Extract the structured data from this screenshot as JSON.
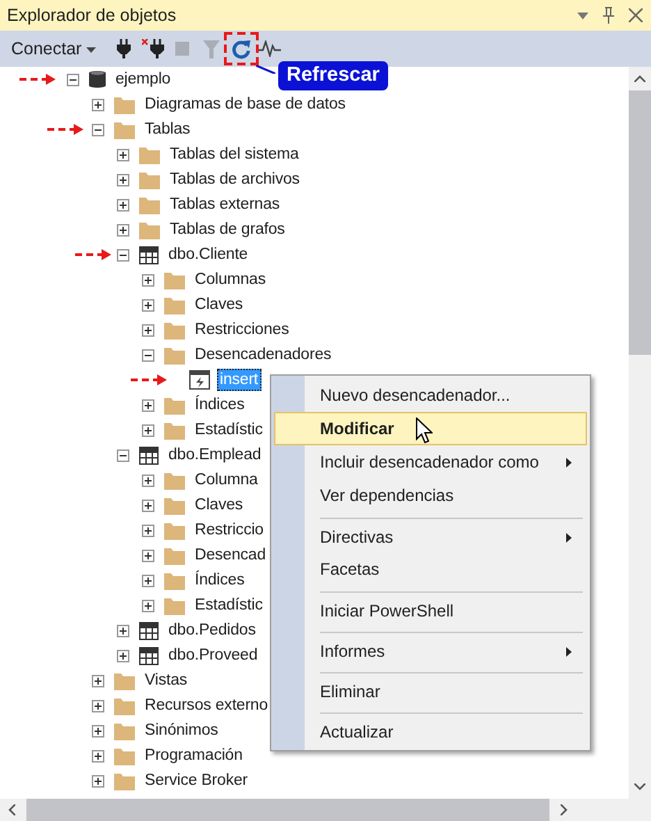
{
  "panel": {
    "title": "Explorador de objetos"
  },
  "toolbar": {
    "connect": "Conectar",
    "buttons": [
      {
        "kind": "connect",
        "disabled": false,
        "highlighted": false
      },
      {
        "kind": "disconnect",
        "disabled": false,
        "highlighted": false
      },
      {
        "kind": "stop",
        "disabled": true,
        "highlighted": false
      },
      {
        "kind": "filter",
        "disabled": true,
        "highlighted": false
      },
      {
        "kind": "refresh",
        "disabled": false,
        "highlighted": true
      },
      {
        "kind": "activity",
        "disabled": false,
        "highlighted": false
      }
    ]
  },
  "callout": {
    "text": "Refrescar"
  },
  "tree": [
    {
      "label": "ejemplo",
      "kind": "database",
      "expanded": true,
      "marked": true,
      "selected": false,
      "children": [
        {
          "label": "Diagramas de base de datos",
          "kind": "folder",
          "expanded": false,
          "marked": false,
          "selected": false
        },
        {
          "label": "Tablas",
          "kind": "folder",
          "expanded": true,
          "marked": true,
          "selected": false,
          "children": [
            {
              "label": "Tablas del sistema",
              "kind": "folder",
              "expanded": false,
              "marked": false,
              "selected": false
            },
            {
              "label": "Tablas de archivos",
              "kind": "folder",
              "expanded": false,
              "marked": false,
              "selected": false
            },
            {
              "label": "Tablas externas",
              "kind": "folder",
              "expanded": false,
              "marked": false,
              "selected": false
            },
            {
              "label": "Tablas de grafos",
              "kind": "folder",
              "expanded": false,
              "marked": false,
              "selected": false
            },
            {
              "label": "dbo.Cliente",
              "kind": "table",
              "expanded": true,
              "marked": true,
              "selected": false,
              "children": [
                {
                  "label": "Columnas",
                  "kind": "folder",
                  "expanded": false,
                  "marked": false,
                  "selected": false
                },
                {
                  "label": "Claves",
                  "kind": "folder",
                  "expanded": false,
                  "marked": false,
                  "selected": false
                },
                {
                  "label": "Restricciones",
                  "kind": "folder",
                  "expanded": false,
                  "marked": false,
                  "selected": false
                },
                {
                  "label": "Desencadenadores",
                  "kind": "folder",
                  "expanded": true,
                  "marked": false,
                  "selected": false,
                  "children": [
                    {
                      "label": "insert",
                      "kind": "trigger",
                      "marked": true,
                      "selected": true
                    }
                  ]
                },
                {
                  "label": "Índices",
                  "kind": "folder",
                  "expanded": false,
                  "marked": false,
                  "selected": false
                },
                {
                  "label": "Estadístic",
                  "kind": "folder",
                  "expanded": false,
                  "marked": false,
                  "selected": false
                }
              ]
            },
            {
              "label": "dbo.Emplead",
              "kind": "table",
              "expanded": true,
              "marked": false,
              "selected": false,
              "children": [
                {
                  "label": "Columna",
                  "kind": "folder",
                  "expanded": false,
                  "marked": false,
                  "selected": false
                },
                {
                  "label": "Claves",
                  "kind": "folder",
                  "expanded": false,
                  "marked": false,
                  "selected": false
                },
                {
                  "label": "Restriccio",
                  "kind": "folder",
                  "expanded": false,
                  "marked": false,
                  "selected": false
                },
                {
                  "label": "Desencad",
                  "kind": "folder",
                  "expanded": false,
                  "marked": false,
                  "selected": false
                },
                {
                  "label": "Índices",
                  "kind": "folder",
                  "expanded": false,
                  "marked": false,
                  "selected": false
                },
                {
                  "label": "Estadístic",
                  "kind": "folder",
                  "expanded": false,
                  "marked": false,
                  "selected": false
                }
              ]
            },
            {
              "label": "dbo.Pedidos",
              "kind": "table",
              "expanded": false,
              "marked": false,
              "selected": false
            },
            {
              "label": "dbo.Proveed",
              "kind": "table",
              "expanded": false,
              "marked": false,
              "selected": false
            }
          ]
        },
        {
          "label": "Vistas",
          "kind": "folder",
          "expanded": false,
          "marked": false,
          "selected": false
        },
        {
          "label": "Recursos externo",
          "kind": "folder",
          "expanded": false,
          "marked": false,
          "selected": false
        },
        {
          "label": "Sinónimos",
          "kind": "folder",
          "expanded": false,
          "marked": false,
          "selected": false
        },
        {
          "label": "Programación",
          "kind": "folder",
          "expanded": false,
          "marked": false,
          "selected": false
        },
        {
          "label": "Service Broker",
          "kind": "folder",
          "expanded": false,
          "marked": false,
          "selected": false
        }
      ]
    }
  ],
  "context_menu": [
    {
      "label": "Nuevo desencadenador...",
      "selected": false,
      "submenu": false,
      "separator_before": false
    },
    {
      "label": "Modificar",
      "selected": true,
      "submenu": false,
      "separator_before": false
    },
    {
      "label": "Incluir desencadenador como",
      "selected": false,
      "submenu": true,
      "separator_before": false
    },
    {
      "label": "Ver dependencias",
      "selected": false,
      "submenu": false,
      "separator_before": false
    },
    {
      "label": "Directivas",
      "selected": false,
      "submenu": true,
      "separator_before": true
    },
    {
      "label": "Facetas",
      "selected": false,
      "submenu": false,
      "separator_before": false
    },
    {
      "label": "Iniciar PowerShell",
      "selected": false,
      "submenu": false,
      "separator_before": true
    },
    {
      "label": "Informes",
      "selected": false,
      "submenu": true,
      "separator_before": true
    },
    {
      "label": "Eliminar",
      "selected": false,
      "submenu": false,
      "separator_before": true
    },
    {
      "label": "Actualizar",
      "selected": false,
      "submenu": false,
      "separator_before": true
    }
  ]
}
